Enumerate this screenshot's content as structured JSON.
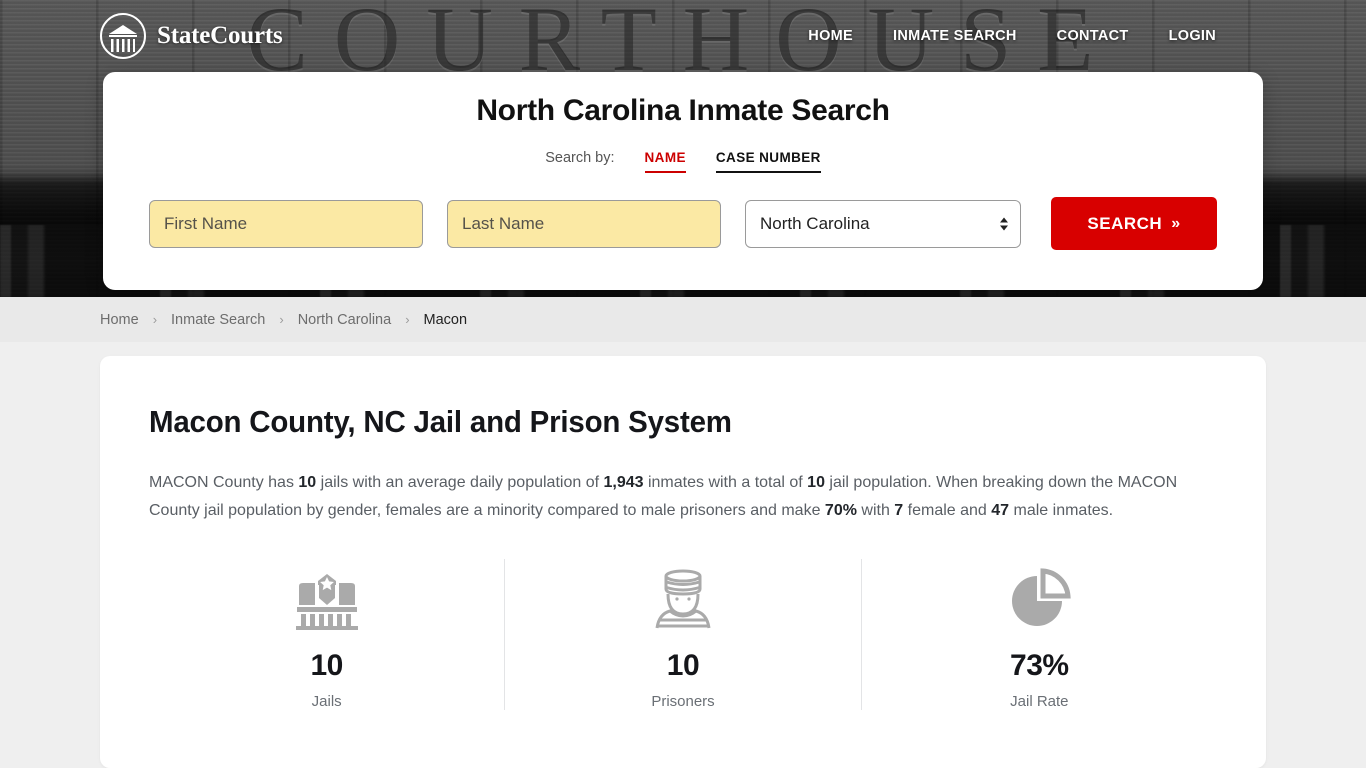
{
  "header": {
    "brand_name": "StateCourts",
    "logo_icon": "courthouse-circle-icon",
    "nav": [
      {
        "label": "HOME"
      },
      {
        "label": "INMATE SEARCH"
      },
      {
        "label": "CONTACT"
      },
      {
        "label": "LOGIN"
      }
    ]
  },
  "search_card": {
    "title": "North Carolina Inmate Search",
    "search_by_label": "Search by:",
    "tabs": [
      {
        "label": "NAME",
        "active": true
      },
      {
        "label": "CASE NUMBER",
        "active": false
      }
    ],
    "first_name": {
      "placeholder": "First Name",
      "value": ""
    },
    "last_name": {
      "placeholder": "Last Name",
      "value": ""
    },
    "state_select": {
      "selected": "North Carolina",
      "options": [
        "North Carolina"
      ]
    },
    "search_button": {
      "label": "SEARCH",
      "chevron": "»"
    },
    "accent_color": "#d80000",
    "autofill_color": "#fbe9a4"
  },
  "breadcrumb": {
    "separator": "›",
    "items": [
      {
        "label": "Home",
        "current": false
      },
      {
        "label": "Inmate Search",
        "current": false
      },
      {
        "label": "North Carolina",
        "current": false
      },
      {
        "label": "Macon",
        "current": true
      }
    ]
  },
  "main": {
    "page_title": "Macon County, NC Jail and Prison System",
    "intro": {
      "p1": "MACON County has ",
      "b1": "10",
      "p2": " jails with an average daily population of ",
      "b2": "1,943",
      "p3": " inmates with a total of ",
      "b3": "10",
      "p4": " jail population. When breaking down the MACON County jail population by gender, females are a minority compared to male prisoners and make ",
      "b4": "70%",
      "p5": " with ",
      "b5": "7",
      "p6": " female and ",
      "b6": "47",
      "p7": " male inmates."
    },
    "stats": [
      {
        "icon": "jail-building-icon",
        "value": "10",
        "label": "Jails"
      },
      {
        "icon": "prisoner-icon",
        "value": "10",
        "label": "Prisoners"
      },
      {
        "icon": "pie-chart-icon",
        "value": "73%",
        "label": "Jail Rate"
      }
    ]
  },
  "hero": {
    "background_word": "COURTHOUSE"
  }
}
